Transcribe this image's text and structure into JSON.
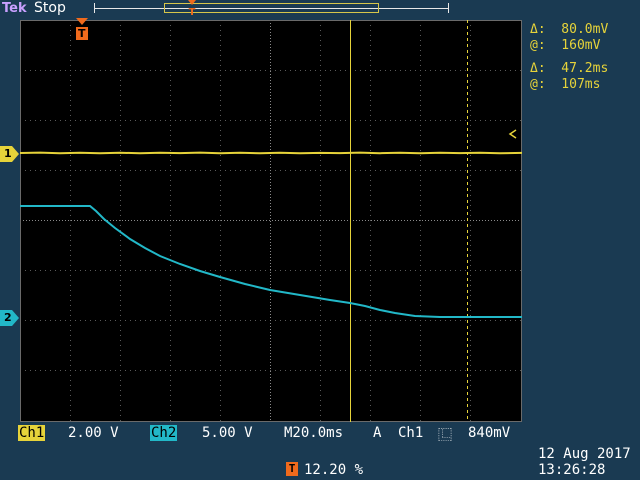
{
  "header": {
    "brand": "Tek",
    "run_state": "Stop"
  },
  "measurements": {
    "delta_voltage": "Δ:  80.0mV",
    "at_voltage": "@:  160mV",
    "delta_time": "Δ:  47.2ms",
    "at_time": "@:  107ms"
  },
  "markers": {
    "ch1": "1",
    "ch2": "2",
    "trigger": "T"
  },
  "status": {
    "ch1_label": "Ch1",
    "ch1_scale": "2.00 V",
    "ch2_label": "Ch2",
    "ch2_scale": "5.00 V",
    "timebase": "M20.0ms",
    "trigger_mode": "A",
    "trigger_source": "Ch1",
    "trigger_slope": "⿺",
    "trigger_level": "840mV"
  },
  "footer": {
    "trigger_position": "12.20 %",
    "date": "12 Aug 2017",
    "time": "13:26:28"
  },
  "colors": {
    "ch1": "#e6d33a",
    "ch2": "#22b8c8",
    "background": "#1a3a52",
    "trigger": "#f06a1c"
  }
}
